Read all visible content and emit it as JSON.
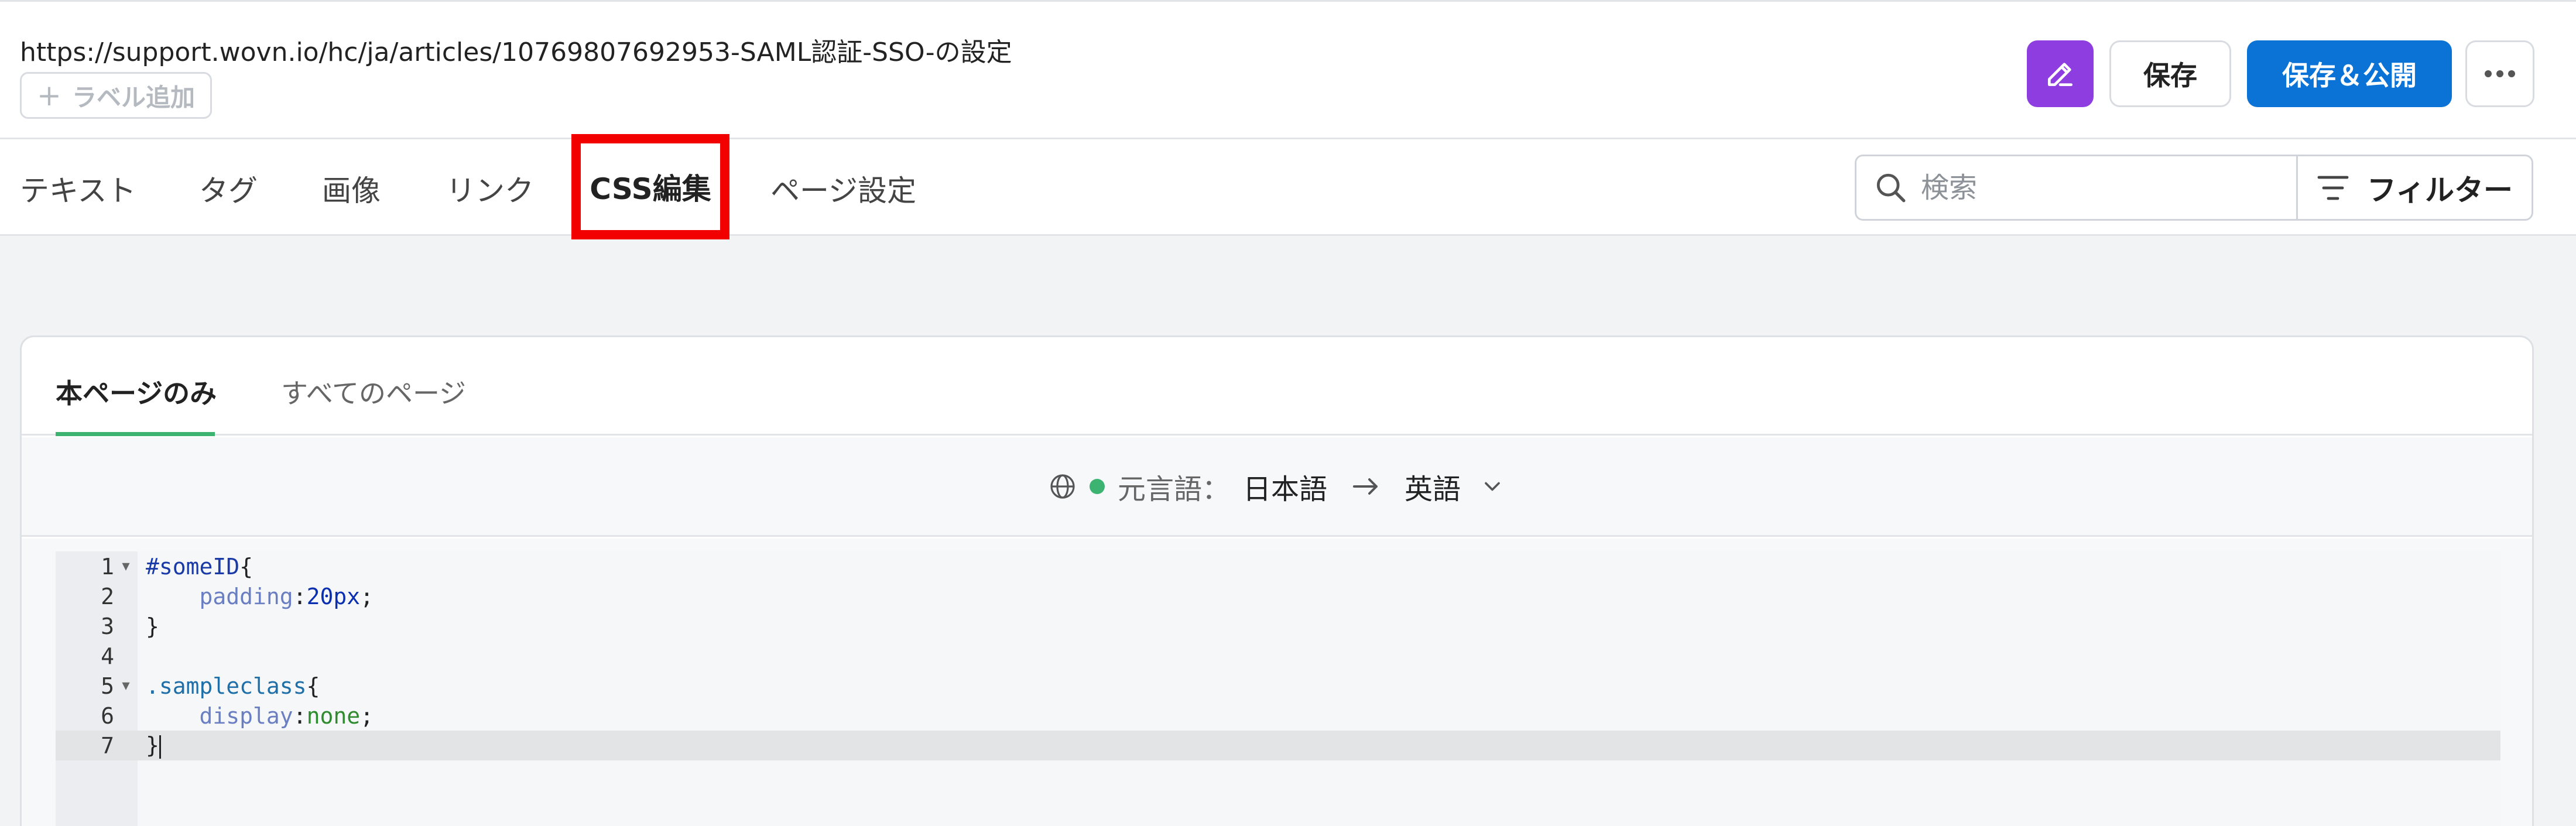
{
  "header": {
    "url": "https://support.wovn.io/hc/ja/articles/10769807692953-SAML認証-SSO-の設定",
    "label_add": "ラベル追加",
    "save_label": "保存",
    "publish_label": "保存＆公開"
  },
  "tabs": [
    {
      "label": "テキスト"
    },
    {
      "label": "タグ"
    },
    {
      "label": "画像"
    },
    {
      "label": "リンク"
    },
    {
      "label": "CSS編集"
    },
    {
      "label": "ページ設定"
    }
  ],
  "search": {
    "placeholder": "検索"
  },
  "filter": {
    "label": "フィルター"
  },
  "panel": {
    "tabs": [
      "本ページのみ",
      "すべてのページ"
    ],
    "source_language_label": "元言語：",
    "source_language": "日本語",
    "target_language": "英語"
  },
  "editor": {
    "line_numbers": [
      "1",
      "2",
      "3",
      "4",
      "5",
      "6",
      "7"
    ],
    "current_line": "7"
  },
  "colors": {
    "primary": "#0b72d6",
    "edit_button": "#8e3de0",
    "highlight_box": "#f20000",
    "active_underline": "#3cb371"
  },
  "icons": [
    "plus-icon",
    "pencil-icon",
    "more-icon",
    "search-icon",
    "filter-icon",
    "globe-icon",
    "arrow-right-icon",
    "chevron-down-icon",
    "fold-arrow-icon"
  ]
}
